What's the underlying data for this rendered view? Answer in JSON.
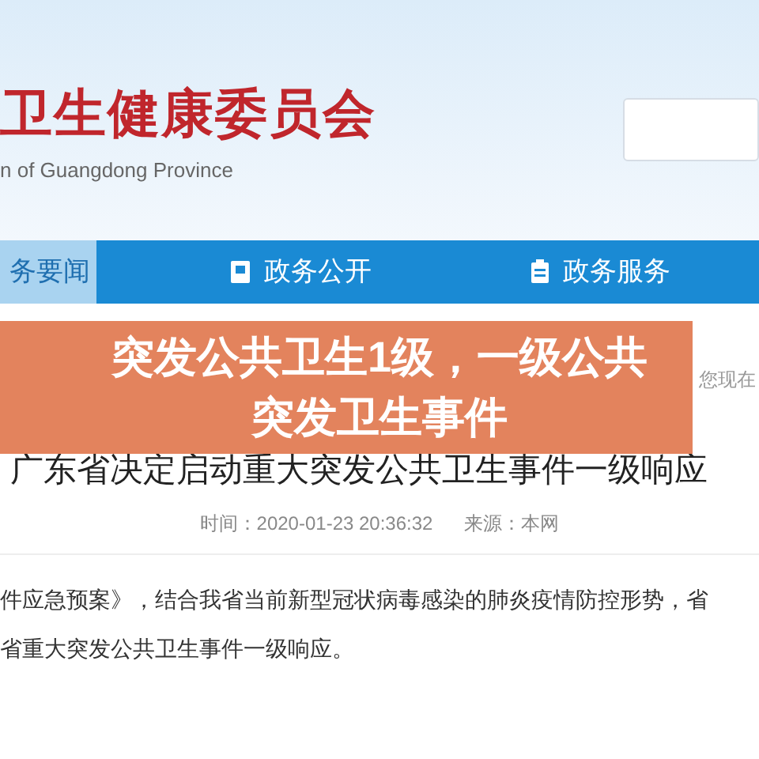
{
  "header": {
    "logo_title": "卫生健康委员会",
    "logo_subtitle": "n of Guangdong Province"
  },
  "nav": [
    {
      "label": "务要闻",
      "selected": true,
      "kind": "plain"
    },
    {
      "label": "政务公开",
      "selected": false,
      "kind": "book"
    },
    {
      "label": "政务服务",
      "selected": false,
      "kind": "clipboard"
    }
  ],
  "overlay_title": [
    "突发公共卫生1级，一级公共",
    "突发卫生事件"
  ],
  "breadcrumb": "您现在",
  "article": {
    "title": "广东省决定启动重大突发公共卫生事件一级响应",
    "time": "时间：2020-01-23 20:36:32",
    "source": "来源：本网",
    "paragraph": [
      "件应急预案》，结合我省当前新型冠状病毒感染的肺炎疫情防控形势，省",
      "省重大突发公共卫生事件一级响应。"
    ]
  }
}
